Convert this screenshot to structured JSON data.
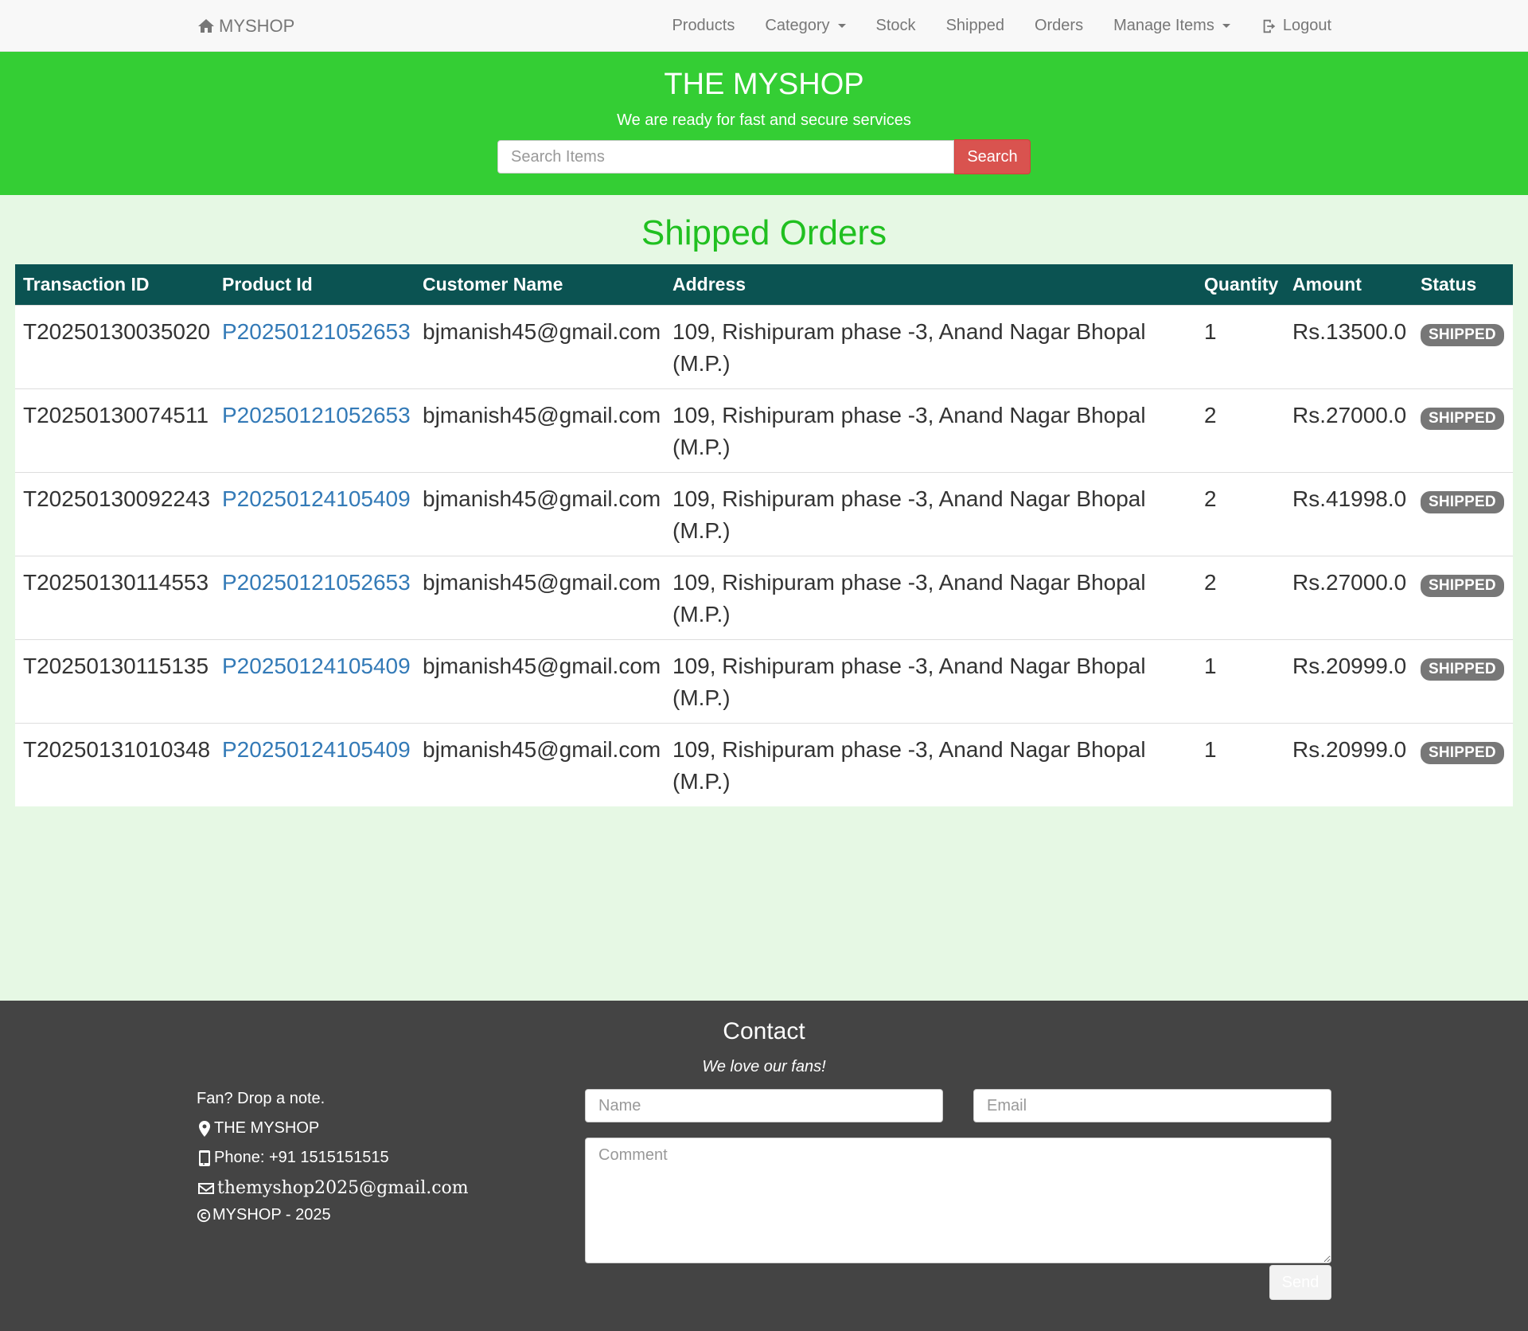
{
  "navbar": {
    "brand": "MYSHOP",
    "links": [
      {
        "label": "Products"
      },
      {
        "label": "Category"
      },
      {
        "label": "Stock"
      },
      {
        "label": "Shipped"
      },
      {
        "label": "Orders"
      },
      {
        "label": "Manage Items"
      },
      {
        "label": "Logout"
      }
    ]
  },
  "hero": {
    "title": "THE MYSHOP",
    "tagline": "We are ready for fast and secure services",
    "search_placeholder": "Search Items",
    "search_button": "Search"
  },
  "orders": {
    "title": "Shipped Orders",
    "columns": [
      "Transaction ID",
      "Product Id",
      "Customer Name",
      "Address",
      "Quantity",
      "Amount",
      "Status"
    ],
    "rows": [
      {
        "transaction_id": "T20250130035020",
        "product_id": "P20250121052653",
        "customer": "bjmanish45@gmail.com",
        "address": "109, Rishipuram phase -3, Anand Nagar Bhopal (M.P.)",
        "quantity": "1",
        "amount": "Rs.13500.0",
        "status": "SHIPPED"
      },
      {
        "transaction_id": "T20250130074511",
        "product_id": "P20250121052653",
        "customer": "bjmanish45@gmail.com",
        "address": "109, Rishipuram phase -3, Anand Nagar Bhopal (M.P.)",
        "quantity": "2",
        "amount": "Rs.27000.0",
        "status": "SHIPPED"
      },
      {
        "transaction_id": "T20250130092243",
        "product_id": "P20250124105409",
        "customer": "bjmanish45@gmail.com",
        "address": "109, Rishipuram phase -3, Anand Nagar Bhopal (M.P.)",
        "quantity": "2",
        "amount": "Rs.41998.0",
        "status": "SHIPPED"
      },
      {
        "transaction_id": "T20250130114553",
        "product_id": "P20250121052653",
        "customer": "bjmanish45@gmail.com",
        "address": "109, Rishipuram phase -3, Anand Nagar Bhopal (M.P.)",
        "quantity": "2",
        "amount": "Rs.27000.0",
        "status": "SHIPPED"
      },
      {
        "transaction_id": "T20250130115135",
        "product_id": "P20250124105409",
        "customer": "bjmanish45@gmail.com",
        "address": "109, Rishipuram phase -3, Anand Nagar Bhopal (M.P.)",
        "quantity": "1",
        "amount": "Rs.20999.0",
        "status": "SHIPPED"
      },
      {
        "transaction_id": "T20250131010348",
        "product_id": "P20250124105409",
        "customer": "bjmanish45@gmail.com",
        "address": "109, Rishipuram phase -3, Anand Nagar Bhopal (M.P.)",
        "quantity": "1",
        "amount": "Rs.20999.0",
        "status": "SHIPPED"
      }
    ]
  },
  "footer": {
    "title": "Contact",
    "subtitle": "We love our fans!",
    "note": "Fan? Drop a note.",
    "shop": "THE MYSHOP",
    "phone": "Phone: +91 1515151515",
    "email": "themyshop2025@gmail.com",
    "copyright": "MYSHOP - 2025",
    "name_placeholder": "Name",
    "email_placeholder": "Email",
    "comment_placeholder": "Comment",
    "send": "Send"
  },
  "colors": {
    "hero_bg": "#34ce34",
    "page_bg": "#e6f8e4",
    "table_header_bg": "#0b5352",
    "title_green": "#20c020",
    "search_button": "#d9534f",
    "footer_bg": "#444444"
  },
  "icons": {
    "brand": "home-icon",
    "logout": "logout-icon",
    "location": "map-marker-icon",
    "phone": "phone-icon",
    "email": "envelope-icon",
    "copyright": "copyright-icon"
  }
}
